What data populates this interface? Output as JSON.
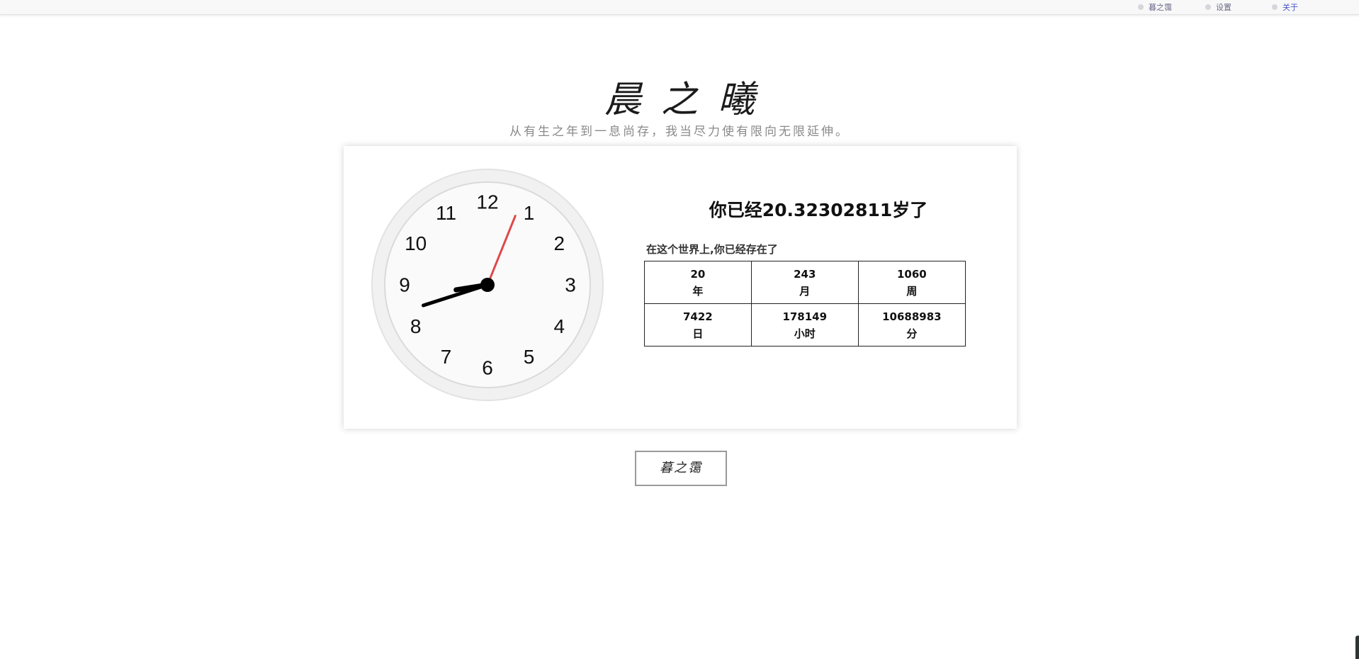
{
  "nav": {
    "items": [
      {
        "label": "暮之霭",
        "active": false
      },
      {
        "label": "设置",
        "active": false
      },
      {
        "label": "关于",
        "active": true
      }
    ]
  },
  "header": {
    "title": "晨之曦",
    "motto": "从有生之年到一息尚存，我当尽力使有限向无限延伸。"
  },
  "clock": {
    "numerals": [
      "12",
      "1",
      "2",
      "3",
      "4",
      "5",
      "6",
      "7",
      "8",
      "9",
      "10",
      "11"
    ],
    "time": {
      "hour": 8,
      "minute": 42,
      "second": 2
    }
  },
  "age": {
    "headline": "你已经20.32302811岁了",
    "caption": "在这个世界上,你已经存在了",
    "stats": [
      {
        "value": "20",
        "unit": "年"
      },
      {
        "value": "243",
        "unit": "月"
      },
      {
        "value": "1060",
        "unit": "周"
      },
      {
        "value": "7422",
        "unit": "日"
      },
      {
        "value": "178149",
        "unit": "小时"
      },
      {
        "value": "10688983",
        "unit": "分"
      }
    ]
  },
  "action": {
    "label": "暮之霭"
  },
  "colors": {
    "accent_link": "#4a56c8",
    "second_hand": "#e0484a",
    "clock_rim": "#e6e6e6"
  }
}
